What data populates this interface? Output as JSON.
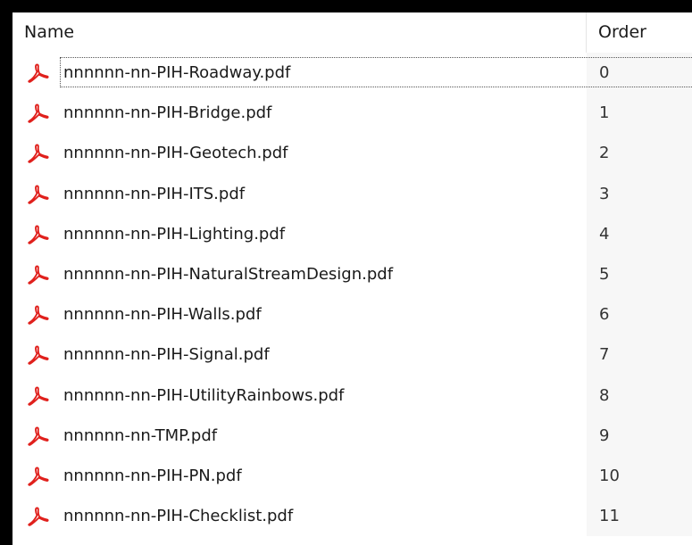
{
  "columns": {
    "name": "Name",
    "order": "Order"
  },
  "icon": "pdf-file-icon",
  "icon_color": "#e0201c",
  "files": [
    {
      "name": "nnnnnn-nn-PIH-Roadway.pdf",
      "order": "0"
    },
    {
      "name": "nnnnnn-nn-PIH-Bridge.pdf",
      "order": "1"
    },
    {
      "name": "nnnnnn-nn-PIH-Geotech.pdf",
      "order": "2"
    },
    {
      "name": "nnnnnn-nn-PIH-ITS.pdf",
      "order": "3"
    },
    {
      "name": "nnnnnn-nn-PIH-Lighting.pdf",
      "order": "4"
    },
    {
      "name": "nnnnnn-nn-PIH-NaturalStreamDesign.pdf",
      "order": "5"
    },
    {
      "name": "nnnnnn-nn-PIH-Walls.pdf",
      "order": "6"
    },
    {
      "name": "nnnnnn-nn-PIH-Signal.pdf",
      "order": "7"
    },
    {
      "name": "nnnnnn-nn-PIH-UtilityRainbows.pdf",
      "order": "8"
    },
    {
      "name": "nnnnnn-nn-TMP.pdf",
      "order": "9"
    },
    {
      "name": "nnnnnn-nn-PIH-PN.pdf",
      "order": "10"
    },
    {
      "name": "nnnnnn-nn-PIH-Checklist.pdf",
      "order": "11"
    }
  ]
}
